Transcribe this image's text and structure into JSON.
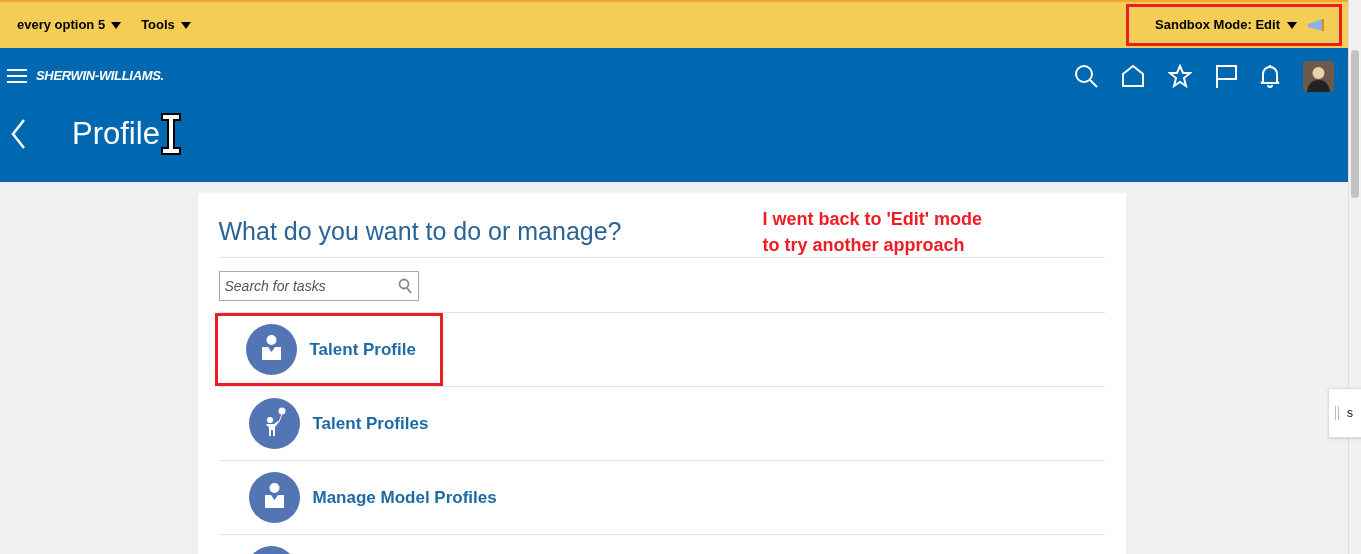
{
  "top_bar": {
    "menus": [
      {
        "label": "every option 5"
      },
      {
        "label": "Tools"
      }
    ],
    "sandbox": {
      "label": "Sandbox Mode: Edit",
      "highlighted": true
    }
  },
  "brand": {
    "logo": "SHERWIN-WILLIAMS."
  },
  "header": {
    "title": "Profile"
  },
  "panel": {
    "heading": "What do you want to do or manage?",
    "annotation": "I went back to 'Edit' mode\nto try another approach",
    "search": {
      "placeholder": "Search for tasks"
    },
    "tasks": [
      {
        "label": "Talent Profile",
        "kind": "person",
        "highlighted": true
      },
      {
        "label": "Talent Profiles",
        "kind": "child",
        "highlighted": false
      },
      {
        "label": "Manage Model Profiles",
        "kind": "person",
        "highlighted": false
      }
    ]
  },
  "side_tab": {
    "label": "s"
  }
}
